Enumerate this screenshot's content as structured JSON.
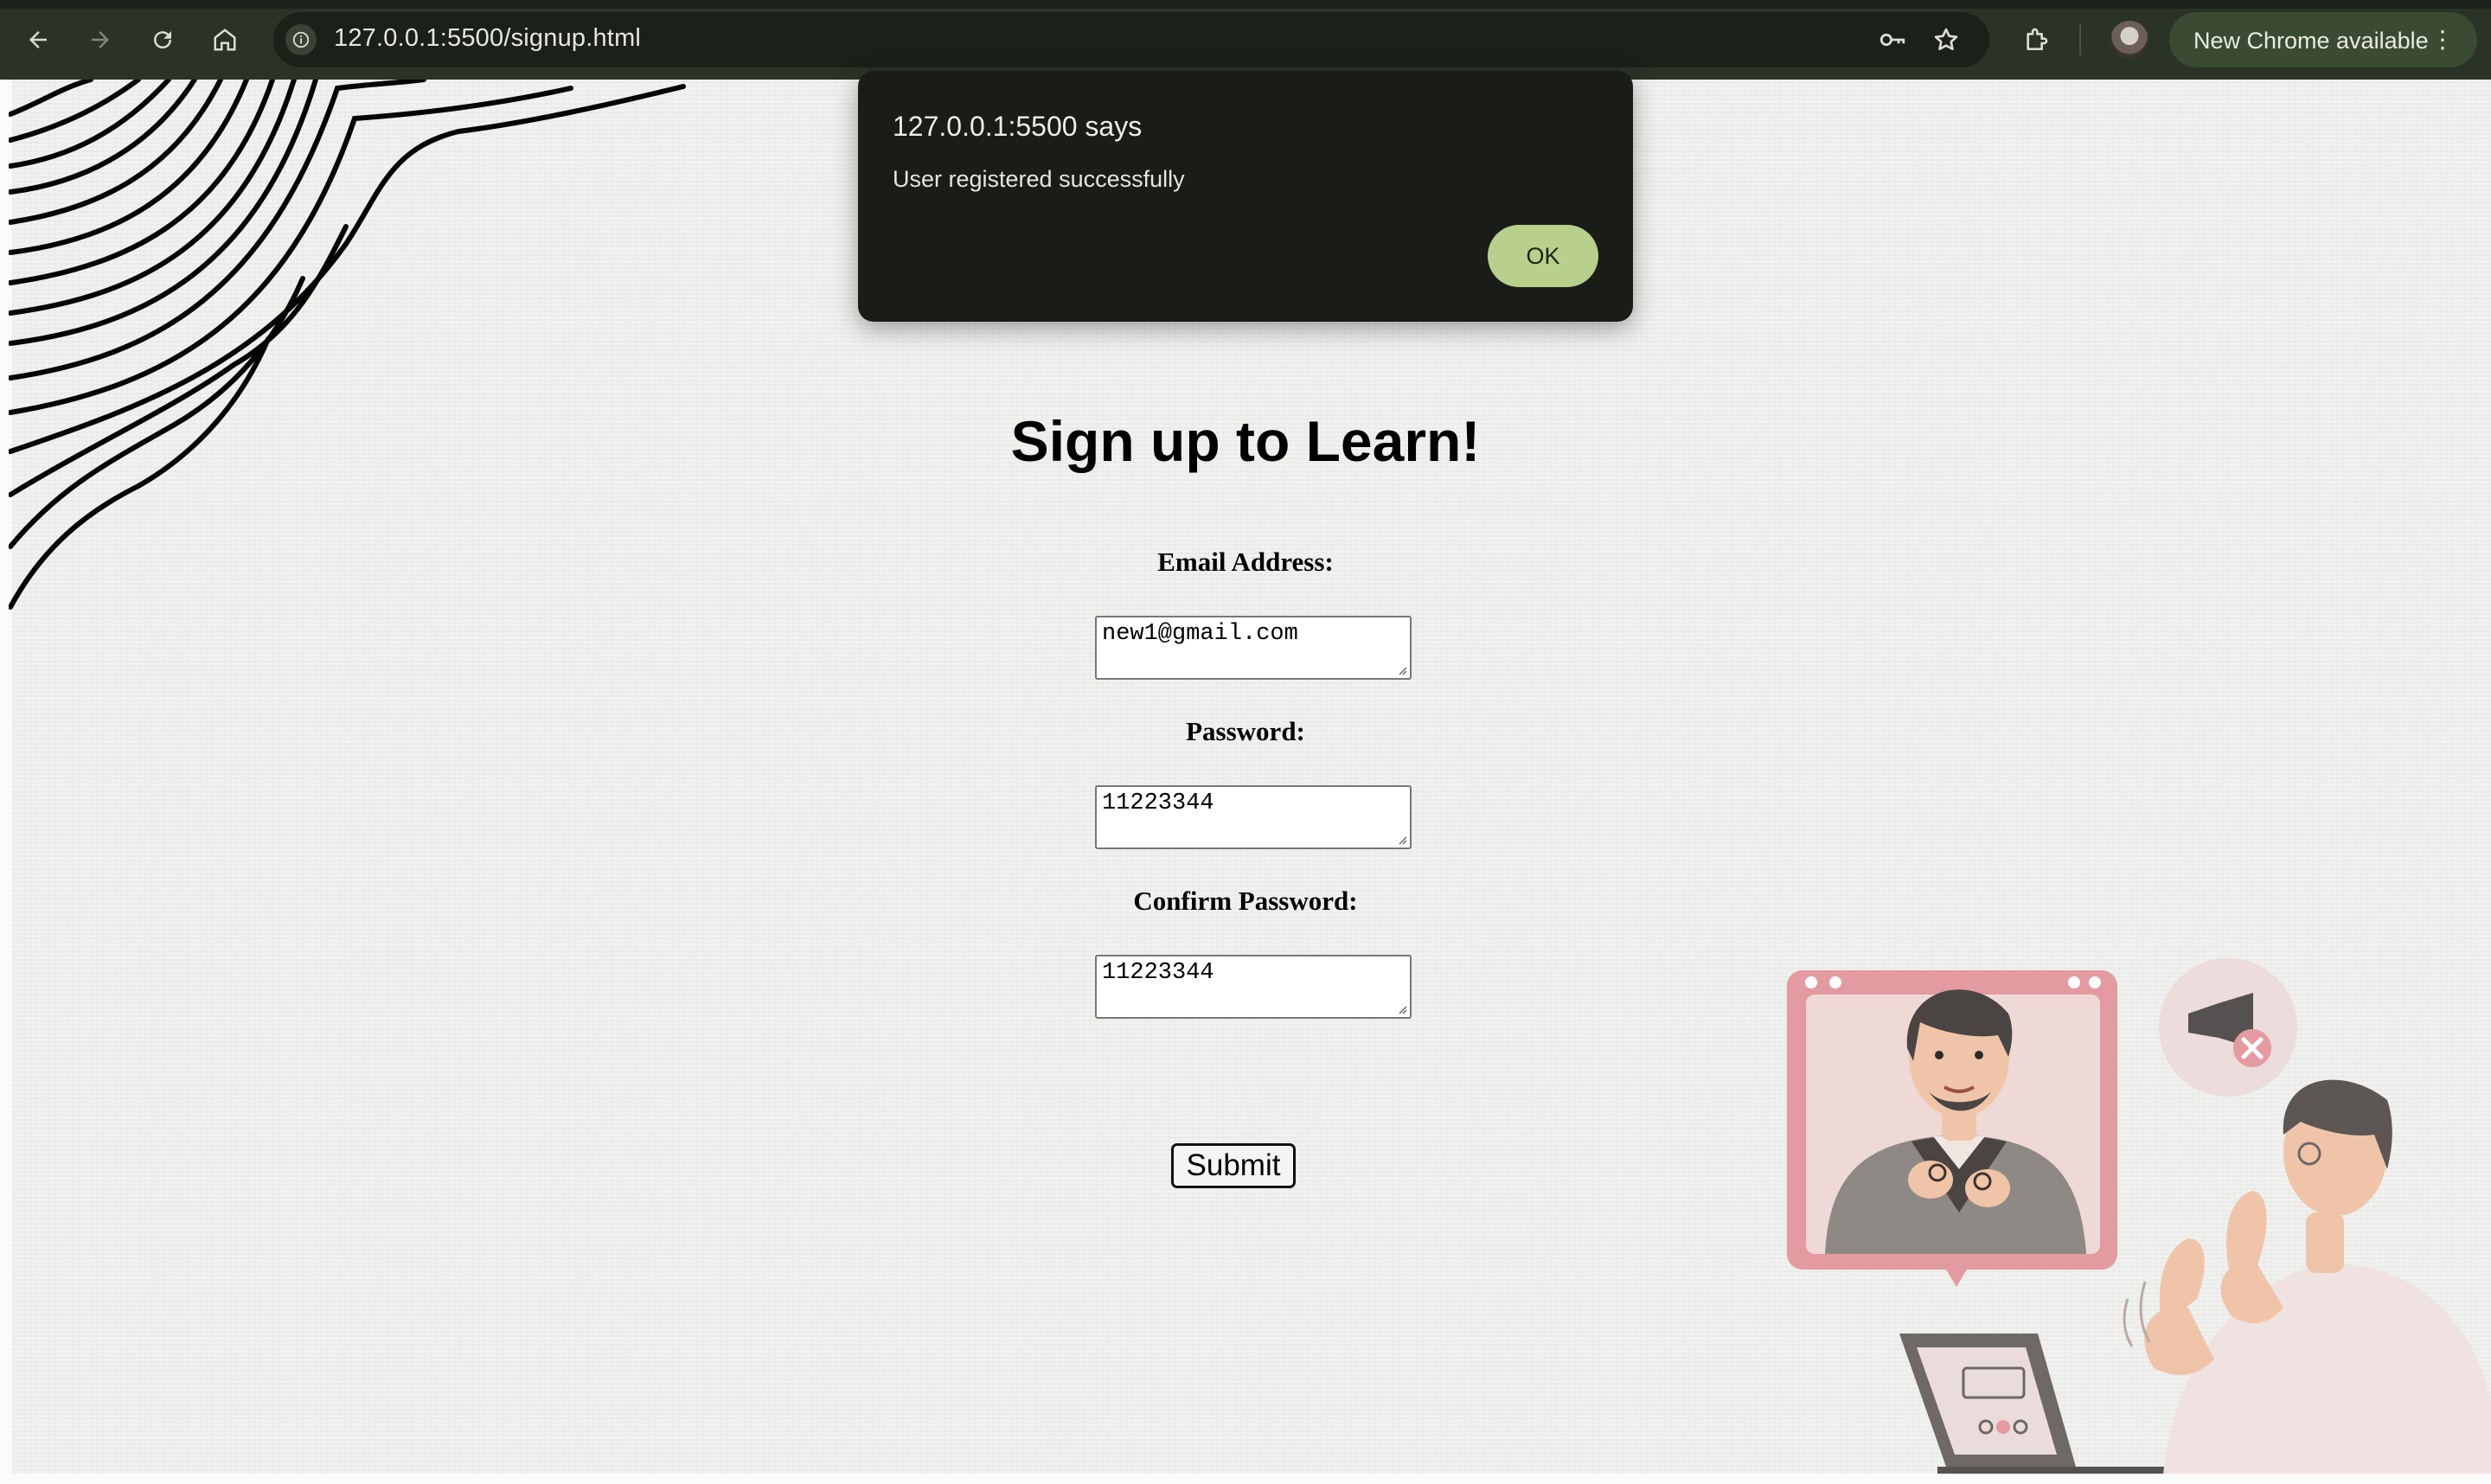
{
  "browser": {
    "url": "127.0.0.1:5500/signup.html",
    "update_label": "New Chrome available",
    "icons": [
      "back-icon",
      "forward-icon",
      "reload-icon",
      "home-icon",
      "site-info-icon",
      "password-key-icon",
      "bookmark-star-icon",
      "extensions-icon",
      "profile-avatar",
      "more-vert-icon"
    ]
  },
  "dialog": {
    "title": "127.0.0.1:5500 says",
    "message": "User registered successfully",
    "ok_label": "OK"
  },
  "form": {
    "heading": "Sign up to Learn!",
    "email_label": "Email Address:",
    "email_value": "new1@gmail.com",
    "password_label": "Password:",
    "password_value": "11223344",
    "confirm_label": "Confirm Password:",
    "confirm_value": "11223344",
    "submit_label": "Submit"
  },
  "colors": {
    "chrome_bg": "#2b3327",
    "dialog_bg": "#1a1c18",
    "ok_button": "#b8d08c",
    "page_bg": "#f1f1ef"
  }
}
